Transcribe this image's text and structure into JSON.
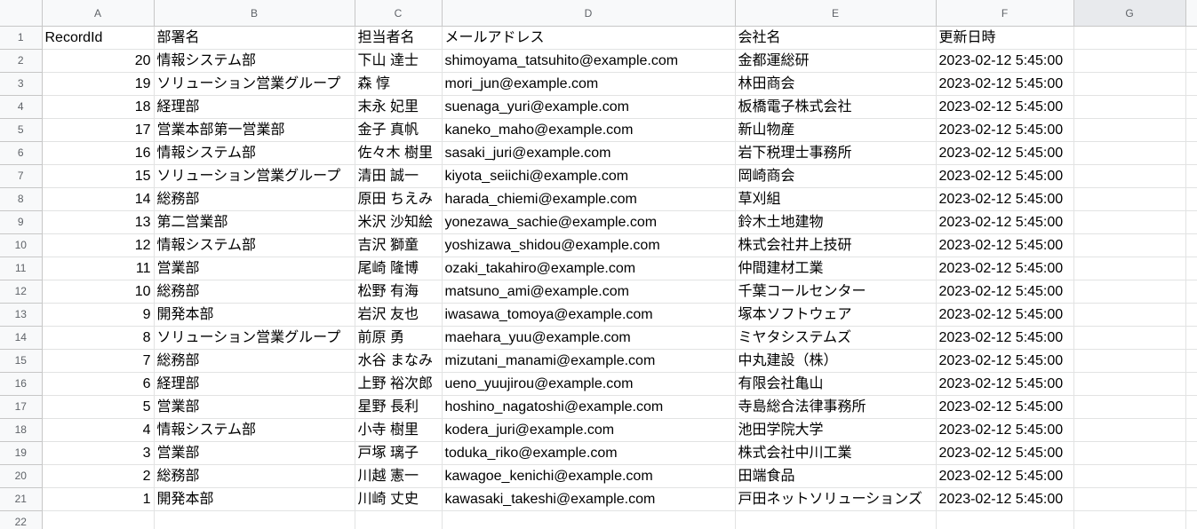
{
  "sheet": {
    "columns": [
      "A",
      "B",
      "C",
      "D",
      "E",
      "F",
      "G"
    ],
    "row_numbers": [
      "1",
      "2",
      "3",
      "4",
      "5",
      "6",
      "7",
      "8",
      "9",
      "10",
      "11",
      "12",
      "13",
      "14",
      "15",
      "16",
      "17",
      "18",
      "19",
      "20",
      "21",
      "22"
    ],
    "header": [
      "RecordId",
      "部署名",
      "担当者名",
      "メールアドレス",
      "会社名",
      "更新日時"
    ],
    "rows": [
      [
        "20",
        "情報システム部",
        "下山 達士",
        "shimoyama_tatsuhito@example.com",
        "金都運総研",
        "2023-02-12 5:45:00"
      ],
      [
        "19",
        "ソリューション営業グループ",
        "森 惇",
        "mori_jun@example.com",
        "林田商会",
        "2023-02-12 5:45:00"
      ],
      [
        "18",
        "経理部",
        "末永 妃里",
        "suenaga_yuri@example.com",
        "板橋電子株式会社",
        "2023-02-12 5:45:00"
      ],
      [
        "17",
        "営業本部第一営業部",
        "金子 真帆",
        "kaneko_maho@example.com",
        "新山物産",
        "2023-02-12 5:45:00"
      ],
      [
        "16",
        "情報システム部",
        "佐々木 樹里",
        "sasaki_juri@example.com",
        "岩下税理士事務所",
        "2023-02-12 5:45:00"
      ],
      [
        "15",
        "ソリューション営業グループ",
        "清田 誠一",
        "kiyota_seiichi@example.com",
        "岡崎商会",
        "2023-02-12 5:45:00"
      ],
      [
        "14",
        "総務部",
        "原田 ちえみ",
        "harada_chiemi@example.com",
        "草刈組",
        "2023-02-12 5:45:00"
      ],
      [
        "13",
        "第二営業部",
        "米沢 沙知絵",
        "yonezawa_sachie@example.com",
        "鈴木土地建物",
        "2023-02-12 5:45:00"
      ],
      [
        "12",
        "情報システム部",
        "吉沢 獅童",
        "yoshizawa_shidou@example.com",
        "株式会社井上技研",
        "2023-02-12 5:45:00"
      ],
      [
        "11",
        "営業部",
        "尾崎 隆博",
        "ozaki_takahiro@example.com",
        "仲間建材工業",
        "2023-02-12 5:45:00"
      ],
      [
        "10",
        "総務部",
        "松野 有海",
        "matsuno_ami@example.com",
        "千葉コールセンター",
        "2023-02-12 5:45:00"
      ],
      [
        "9",
        "開発本部",
        "岩沢 友也",
        "iwasawa_tomoya@example.com",
        "塚本ソフトウェア",
        "2023-02-12 5:45:00"
      ],
      [
        "8",
        "ソリューション営業グループ",
        "前原 勇",
        "maehara_yuu@example.com",
        "ミヤタシステムズ",
        "2023-02-12 5:45:00"
      ],
      [
        "7",
        "総務部",
        "水谷 まなみ",
        "mizutani_manami@example.com",
        "中丸建設（株）",
        "2023-02-12 5:45:00"
      ],
      [
        "6",
        "経理部",
        "上野 裕次郎",
        "ueno_yuujirou@example.com",
        "有限会社亀山",
        "2023-02-12 5:45:00"
      ],
      [
        "5",
        "営業部",
        "星野 長利",
        "hoshino_nagatoshi@example.com",
        "寺島総合法律事務所",
        "2023-02-12 5:45:00"
      ],
      [
        "4",
        "情報システム部",
        "小寺 樹里",
        "kodera_juri@example.com",
        "池田学院大学",
        "2023-02-12 5:45:00"
      ],
      [
        "3",
        "営業部",
        "戸塚 璃子",
        "toduka_riko@example.com",
        "株式会社中川工業",
        "2023-02-12 5:45:00"
      ],
      [
        "2",
        "総務部",
        "川越 憲一",
        "kawagoe_kenichi@example.com",
        "田端食品",
        "2023-02-12 5:45:00"
      ],
      [
        "1",
        "開発本部",
        "川崎 丈史",
        "kawasaki_takeshi@example.com",
        "戸田ネットソリューションズ",
        "2023-02-12 5:45:00"
      ]
    ]
  }
}
